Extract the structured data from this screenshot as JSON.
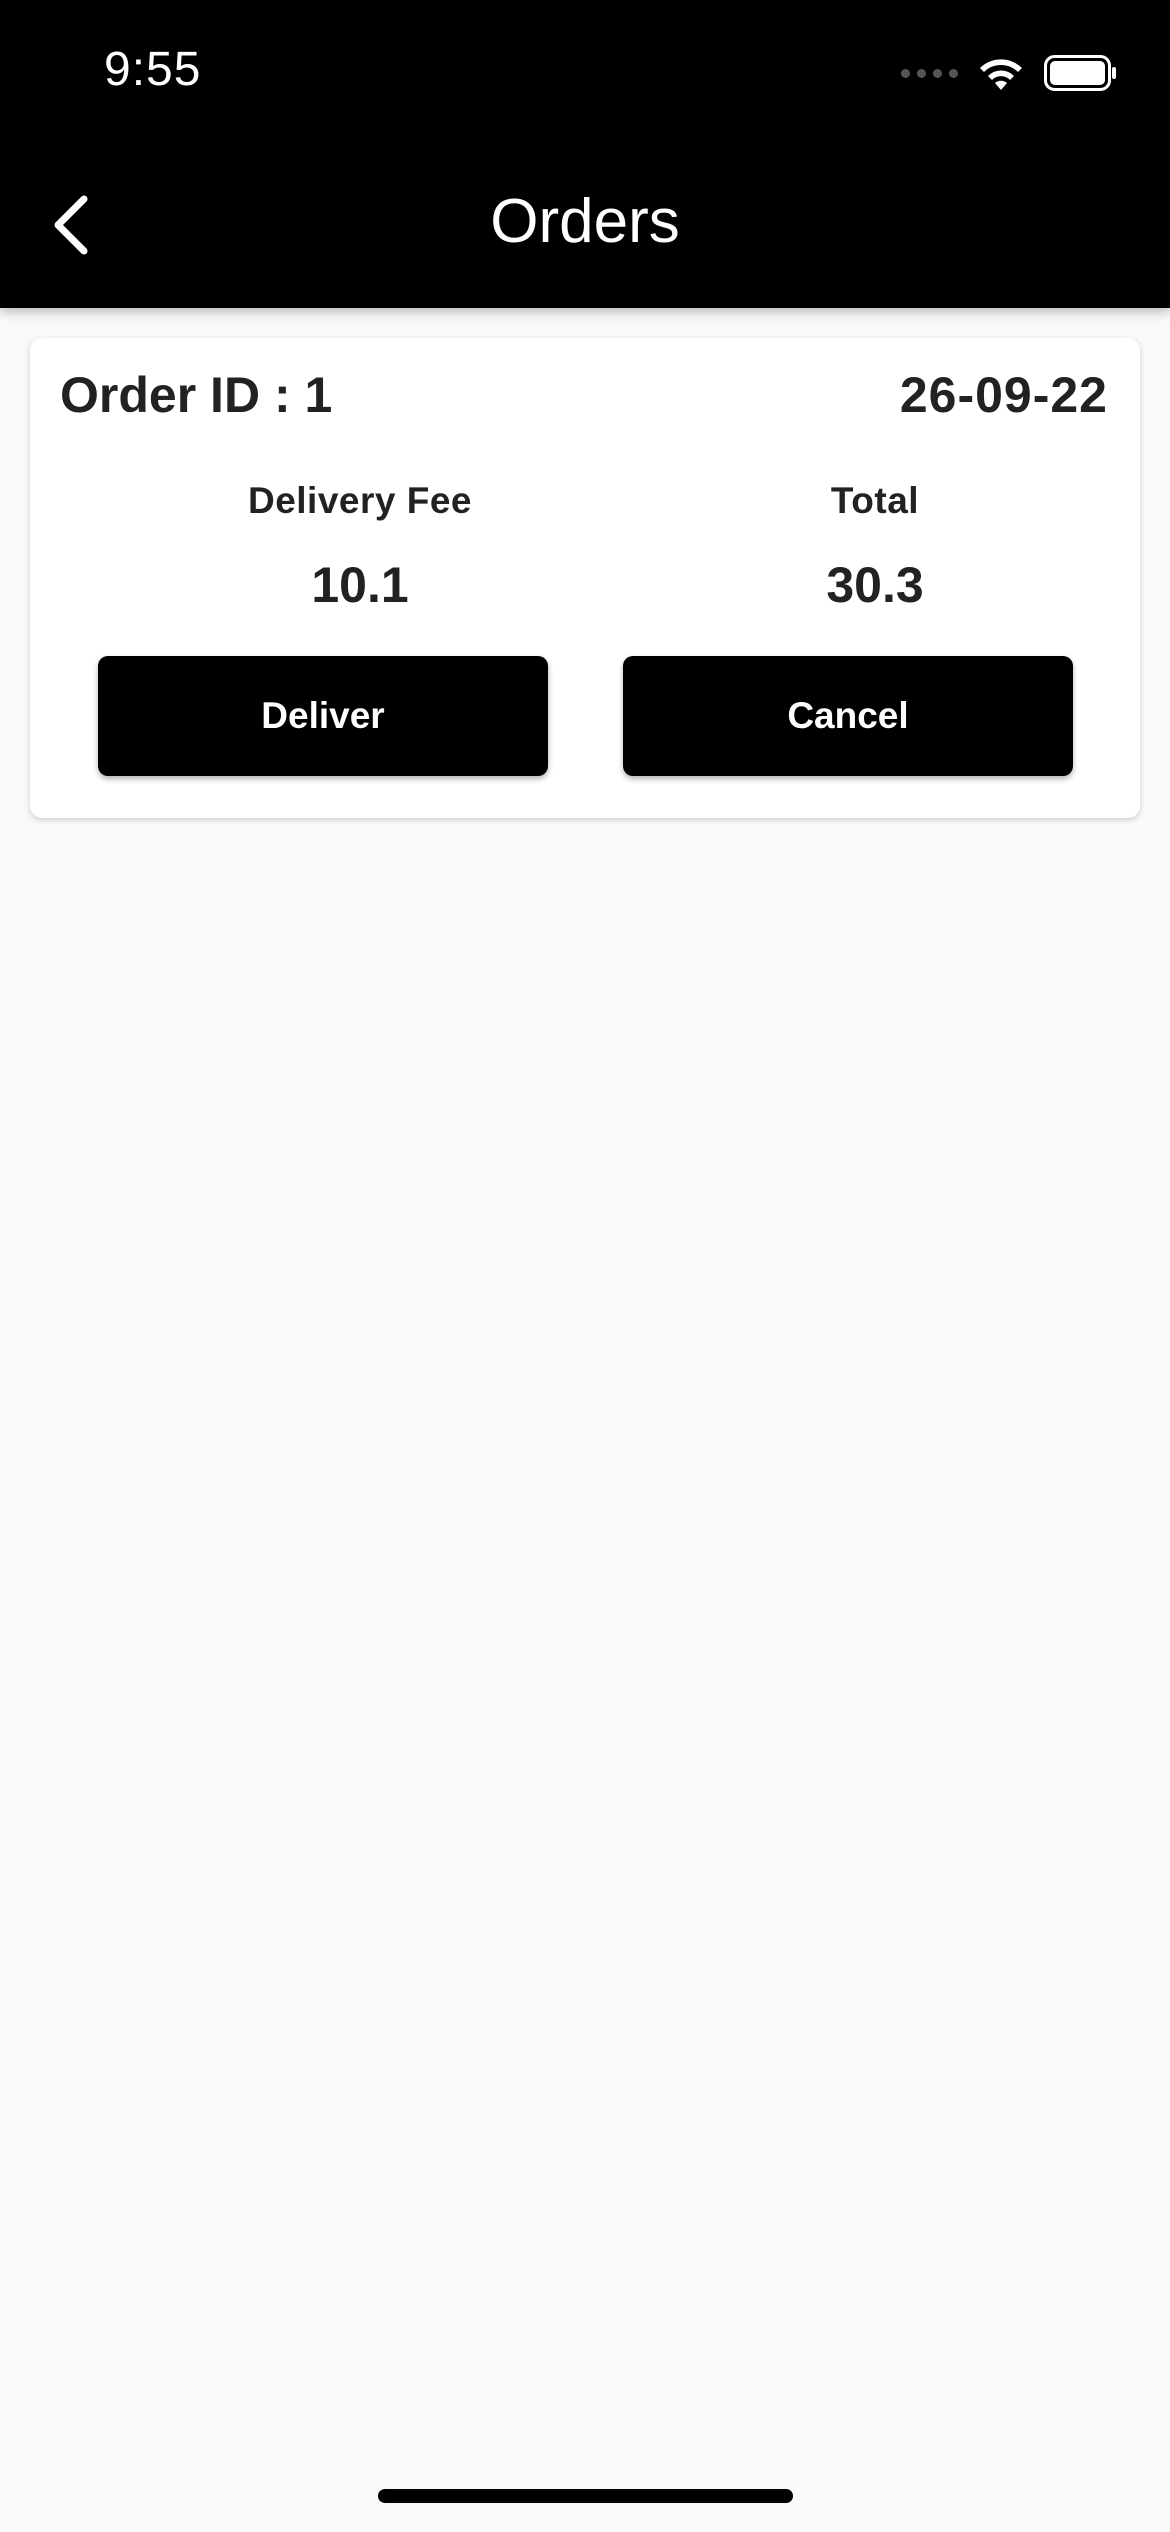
{
  "status_bar": {
    "time": "9:55",
    "icons": [
      "signal-icon",
      "wifi-icon",
      "battery-icon"
    ]
  },
  "app_bar": {
    "title": "Orders",
    "back_icon": "chevron-left-icon"
  },
  "orders": [
    {
      "order_id_text": "Order ID : 1",
      "date": "26-09-22",
      "delivery_fee_label": "Delivery Fee",
      "delivery_fee_value": "10.1",
      "total_label": "Total",
      "total_value": "30.3",
      "deliver_label": "Deliver",
      "cancel_label": "Cancel"
    }
  ],
  "colors": {
    "header_bg": "#000000",
    "page_bg": "#f9f9f9",
    "card_bg": "#ffffff",
    "button_bg": "#000000",
    "text_primary": "#222222"
  }
}
